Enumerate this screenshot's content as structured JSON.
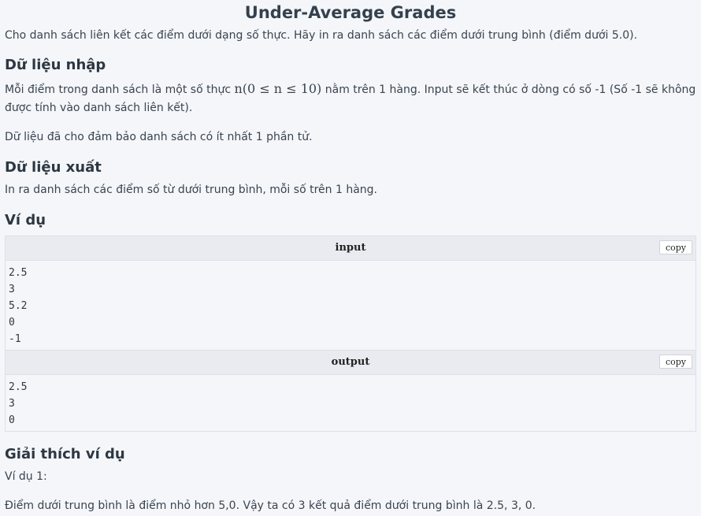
{
  "title": "Under-Average Grades",
  "intro": "Cho danh sách liên kết các điểm dưới dạng số thực. Hãy in ra danh sách các điểm dưới trung bình (điểm dưới 5.0).",
  "input_section": {
    "heading": "Dữ liệu nhập",
    "desc_before": "Mỗi điểm trong danh sách là một số thực",
    "desc_math": "n(0 ≤ n ≤ 10)",
    "desc_after": "nằm trên 1 hàng. Input sẽ kết thúc ở dòng có số -1 (Số -1 sẽ không được tính vào danh sách liên kết).",
    "guarantee": "Dữ liệu đã cho đảm bảo danh sách có ít nhất 1 phần tử."
  },
  "output_section": {
    "heading": "Dữ liệu xuất",
    "desc": "In ra danh sách các điểm số từ dưới trung bình, mỗi số trên 1 hàng."
  },
  "example": {
    "heading": "Ví dụ",
    "input_label": "input",
    "output_label": "output",
    "copy_label": "copy",
    "input_lines": [
      "2.5",
      "3",
      "5.2",
      "0",
      "-1"
    ],
    "output_lines": [
      "2.5",
      "3",
      "0"
    ]
  },
  "explanation": {
    "heading": "Giải thích ví dụ",
    "example_label": "Ví dụ 1:",
    "text": "Điểm dưới trung bình là điểm nhỏ hơn 5,0. Vậy ta có 3 kết quả điểm dưới trung bình là 2.5, 3, 0."
  }
}
